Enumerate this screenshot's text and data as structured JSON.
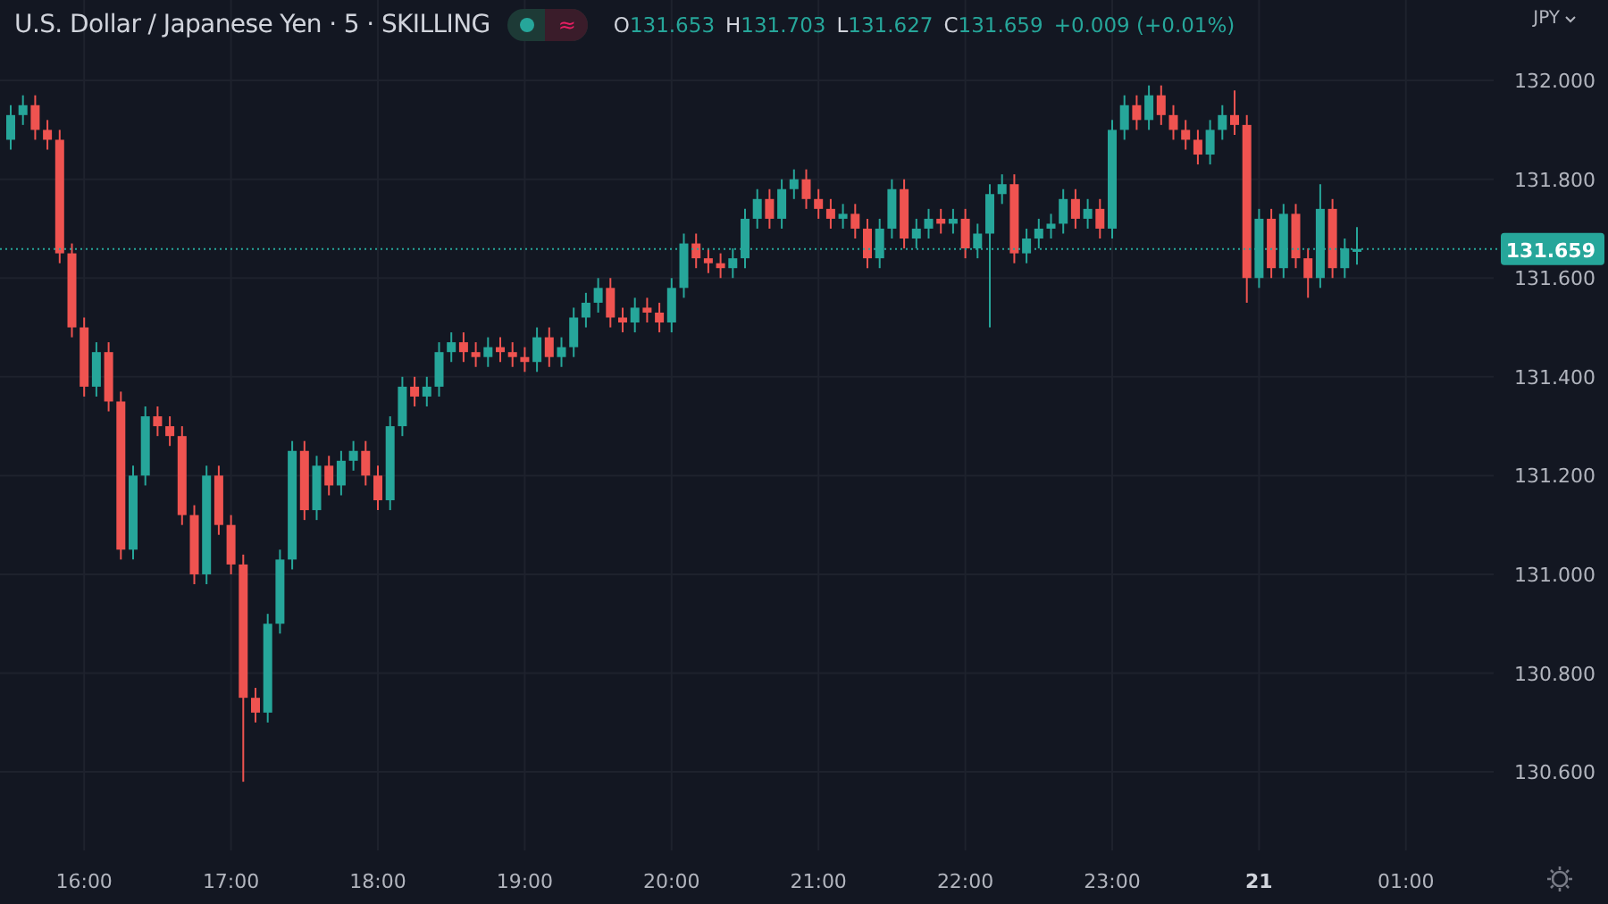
{
  "header": {
    "title": "U.S. Dollar / Japanese Yen · 5 · SKILLING",
    "status_badge": {
      "live": true,
      "symbol": "≈"
    },
    "ohlc": [
      {
        "label": "O",
        "value": "131.653"
      },
      {
        "label": "H",
        "value": "131.703"
      },
      {
        "label": "L",
        "value": "131.627"
      },
      {
        "label": "C",
        "value": "131.659"
      }
    ],
    "change": "+0.009 (+0.01%)"
  },
  "currency": "JPY",
  "chart_data": {
    "type": "candlestick",
    "grid": true,
    "ref_lines": [
      {
        "axis": "y",
        "value": 131.659,
        "label": "131.659",
        "color": "#26a69a"
      }
    ],
    "yticks": [
      {
        "value": 132,
        "label": "132.000"
      },
      {
        "value": 131.8,
        "label": "131.800"
      },
      {
        "value": 131.6,
        "label": "131.600"
      },
      {
        "value": 131.4,
        "label": "131.400"
      },
      {
        "value": 131.2,
        "label": "131.200"
      },
      {
        "value": 131,
        "label": "131.000"
      },
      {
        "value": 130.8,
        "label": "130.800"
      },
      {
        "value": 130.6,
        "label": "130.600"
      }
    ],
    "ylim": [
      130.441,
      132.163
    ],
    "categories": [
      null,
      null,
      null,
      null,
      null,
      null,
      "16:00",
      null,
      null,
      null,
      null,
      null,
      null,
      null,
      null,
      null,
      null,
      null,
      "17:00",
      null,
      null,
      null,
      null,
      null,
      null,
      null,
      null,
      null,
      null,
      null,
      "18:00",
      null,
      null,
      null,
      null,
      null,
      null,
      null,
      null,
      null,
      null,
      null,
      "19:00",
      null,
      null,
      null,
      null,
      null,
      null,
      null,
      null,
      null,
      null,
      null,
      "20:00",
      null,
      null,
      null,
      null,
      null,
      null,
      null,
      null,
      null,
      null,
      null,
      "21:00",
      null,
      null,
      null,
      null,
      null,
      null,
      null,
      null,
      null,
      null,
      null,
      "22:00",
      null,
      null,
      null,
      null,
      null,
      null,
      null,
      null,
      null,
      null,
      null,
      "23:00",
      null,
      null,
      null,
      null,
      null,
      null,
      null,
      null,
      null,
      null,
      null,
      "21",
      null,
      null,
      null,
      null,
      null,
      null,
      null,
      null,
      null,
      null,
      null,
      "01:00"
    ],
    "ohlc": [
      [
        131.88,
        131.95,
        131.86,
        131.93
      ],
      [
        131.93,
        131.97,
        131.91,
        131.95
      ],
      [
        131.95,
        131.97,
        131.88,
        131.9
      ],
      [
        131.9,
        131.92,
        131.86,
        131.88
      ],
      [
        131.88,
        131.9,
        131.63,
        131.65
      ],
      [
        131.65,
        131.67,
        131.48,
        131.5
      ],
      [
        131.5,
        131.52,
        131.36,
        131.38
      ],
      [
        131.38,
        131.47,
        131.36,
        131.45
      ],
      [
        131.45,
        131.47,
        131.33,
        131.35
      ],
      [
        131.35,
        131.37,
        131.03,
        131.05
      ],
      [
        131.05,
        131.22,
        131.03,
        131.2
      ],
      [
        131.2,
        131.34,
        131.18,
        131.32
      ],
      [
        131.32,
        131.34,
        131.28,
        131.3
      ],
      [
        131.3,
        131.32,
        131.26,
        131.28
      ],
      [
        131.28,
        131.3,
        131.1,
        131.12
      ],
      [
        131.12,
        131.14,
        130.98,
        131.0
      ],
      [
        131.0,
        131.22,
        130.98,
        131.2
      ],
      [
        131.2,
        131.22,
        131.08,
        131.1
      ],
      [
        131.1,
        131.12,
        131.0,
        131.02
      ],
      [
        131.02,
        131.04,
        130.58,
        130.75
      ],
      [
        130.75,
        130.77,
        130.7,
        130.72
      ],
      [
        130.72,
        130.92,
        130.7,
        130.9
      ],
      [
        130.9,
        131.05,
        130.88,
        131.03
      ],
      [
        131.03,
        131.27,
        131.01,
        131.25
      ],
      [
        131.25,
        131.27,
        131.11,
        131.13
      ],
      [
        131.13,
        131.24,
        131.11,
        131.22
      ],
      [
        131.22,
        131.24,
        131.16,
        131.18
      ],
      [
        131.18,
        131.25,
        131.16,
        131.23
      ],
      [
        131.23,
        131.27,
        131.21,
        131.25
      ],
      [
        131.25,
        131.27,
        131.18,
        131.2
      ],
      [
        131.2,
        131.22,
        131.13,
        131.15
      ],
      [
        131.15,
        131.32,
        131.13,
        131.3
      ],
      [
        131.3,
        131.4,
        131.28,
        131.38
      ],
      [
        131.38,
        131.4,
        131.34,
        131.36
      ],
      [
        131.36,
        131.4,
        131.34,
        131.38
      ],
      [
        131.38,
        131.47,
        131.36,
        131.45
      ],
      [
        131.45,
        131.49,
        131.43,
        131.47
      ],
      [
        131.47,
        131.49,
        131.43,
        131.45
      ],
      [
        131.45,
        131.47,
        131.42,
        131.44
      ],
      [
        131.44,
        131.48,
        131.42,
        131.46
      ],
      [
        131.46,
        131.48,
        131.43,
        131.45
      ],
      [
        131.45,
        131.47,
        131.42,
        131.44
      ],
      [
        131.44,
        131.46,
        131.41,
        131.43
      ],
      [
        131.43,
        131.5,
        131.41,
        131.48
      ],
      [
        131.48,
        131.5,
        131.42,
        131.44
      ],
      [
        131.44,
        131.48,
        131.42,
        131.46
      ],
      [
        131.46,
        131.54,
        131.44,
        131.52
      ],
      [
        131.52,
        131.57,
        131.5,
        131.55
      ],
      [
        131.55,
        131.6,
        131.53,
        131.58
      ],
      [
        131.58,
        131.6,
        131.5,
        131.52
      ],
      [
        131.52,
        131.54,
        131.49,
        131.51
      ],
      [
        131.51,
        131.56,
        131.49,
        131.54
      ],
      [
        131.54,
        131.56,
        131.51,
        131.53
      ],
      [
        131.53,
        131.55,
        131.49,
        131.51
      ],
      [
        131.51,
        131.6,
        131.49,
        131.58
      ],
      [
        131.58,
        131.69,
        131.56,
        131.67
      ],
      [
        131.67,
        131.69,
        131.62,
        131.64
      ],
      [
        131.64,
        131.66,
        131.61,
        131.63
      ],
      [
        131.63,
        131.65,
        131.6,
        131.62
      ],
      [
        131.62,
        131.66,
        131.6,
        131.64
      ],
      [
        131.64,
        131.74,
        131.62,
        131.72
      ],
      [
        131.72,
        131.78,
        131.7,
        131.76
      ],
      [
        131.76,
        131.78,
        131.7,
        131.72
      ],
      [
        131.72,
        131.8,
        131.7,
        131.78
      ],
      [
        131.78,
        131.82,
        131.76,
        131.8
      ],
      [
        131.8,
        131.82,
        131.74,
        131.76
      ],
      [
        131.76,
        131.78,
        131.72,
        131.74
      ],
      [
        131.74,
        131.76,
        131.7,
        131.72
      ],
      [
        131.72,
        131.75,
        131.7,
        131.73
      ],
      [
        131.73,
        131.75,
        131.68,
        131.7
      ],
      [
        131.7,
        131.72,
        131.62,
        131.64
      ],
      [
        131.64,
        131.72,
        131.62,
        131.7
      ],
      [
        131.7,
        131.8,
        131.68,
        131.78
      ],
      [
        131.78,
        131.8,
        131.66,
        131.68
      ],
      [
        131.68,
        131.72,
        131.66,
        131.7
      ],
      [
        131.7,
        131.74,
        131.68,
        131.72
      ],
      [
        131.72,
        131.74,
        131.69,
        131.71
      ],
      [
        131.71,
        131.74,
        131.69,
        131.72
      ],
      [
        131.72,
        131.74,
        131.64,
        131.66
      ],
      [
        131.66,
        131.71,
        131.64,
        131.69
      ],
      [
        131.69,
        131.79,
        131.5,
        131.77
      ],
      [
        131.77,
        131.81,
        131.75,
        131.79
      ],
      [
        131.79,
        131.81,
        131.63,
        131.65
      ],
      [
        131.65,
        131.7,
        131.63,
        131.68
      ],
      [
        131.68,
        131.72,
        131.66,
        131.7
      ],
      [
        131.7,
        131.73,
        131.68,
        131.71
      ],
      [
        131.71,
        131.78,
        131.69,
        131.76
      ],
      [
        131.76,
        131.78,
        131.7,
        131.72
      ],
      [
        131.72,
        131.76,
        131.7,
        131.74
      ],
      [
        131.74,
        131.76,
        131.68,
        131.7
      ],
      [
        131.7,
        131.92,
        131.68,
        131.9
      ],
      [
        131.9,
        131.97,
        131.88,
        131.95
      ],
      [
        131.95,
        131.97,
        131.9,
        131.92
      ],
      [
        131.92,
        131.99,
        131.9,
        131.97
      ],
      [
        131.97,
        131.99,
        131.91,
        131.93
      ],
      [
        131.93,
        131.95,
        131.88,
        131.9
      ],
      [
        131.9,
        131.92,
        131.86,
        131.88
      ],
      [
        131.88,
        131.9,
        131.83,
        131.85
      ],
      [
        131.85,
        131.92,
        131.83,
        131.9
      ],
      [
        131.9,
        131.95,
        131.88,
        131.93
      ],
      [
        131.93,
        131.98,
        131.89,
        131.91
      ],
      [
        131.91,
        131.93,
        131.55,
        131.6
      ],
      [
        131.6,
        131.74,
        131.58,
        131.72
      ],
      [
        131.72,
        131.74,
        131.6,
        131.62
      ],
      [
        131.62,
        131.75,
        131.6,
        131.73
      ],
      [
        131.73,
        131.75,
        131.62,
        131.64
      ],
      [
        131.64,
        131.66,
        131.56,
        131.6
      ],
      [
        131.6,
        131.79,
        131.58,
        131.74
      ],
      [
        131.74,
        131.76,
        131.6,
        131.62
      ],
      [
        131.62,
        131.68,
        131.6,
        131.66
      ],
      [
        131.653,
        131.703,
        131.627,
        131.659
      ],
      null,
      null,
      null,
      null
    ]
  }
}
